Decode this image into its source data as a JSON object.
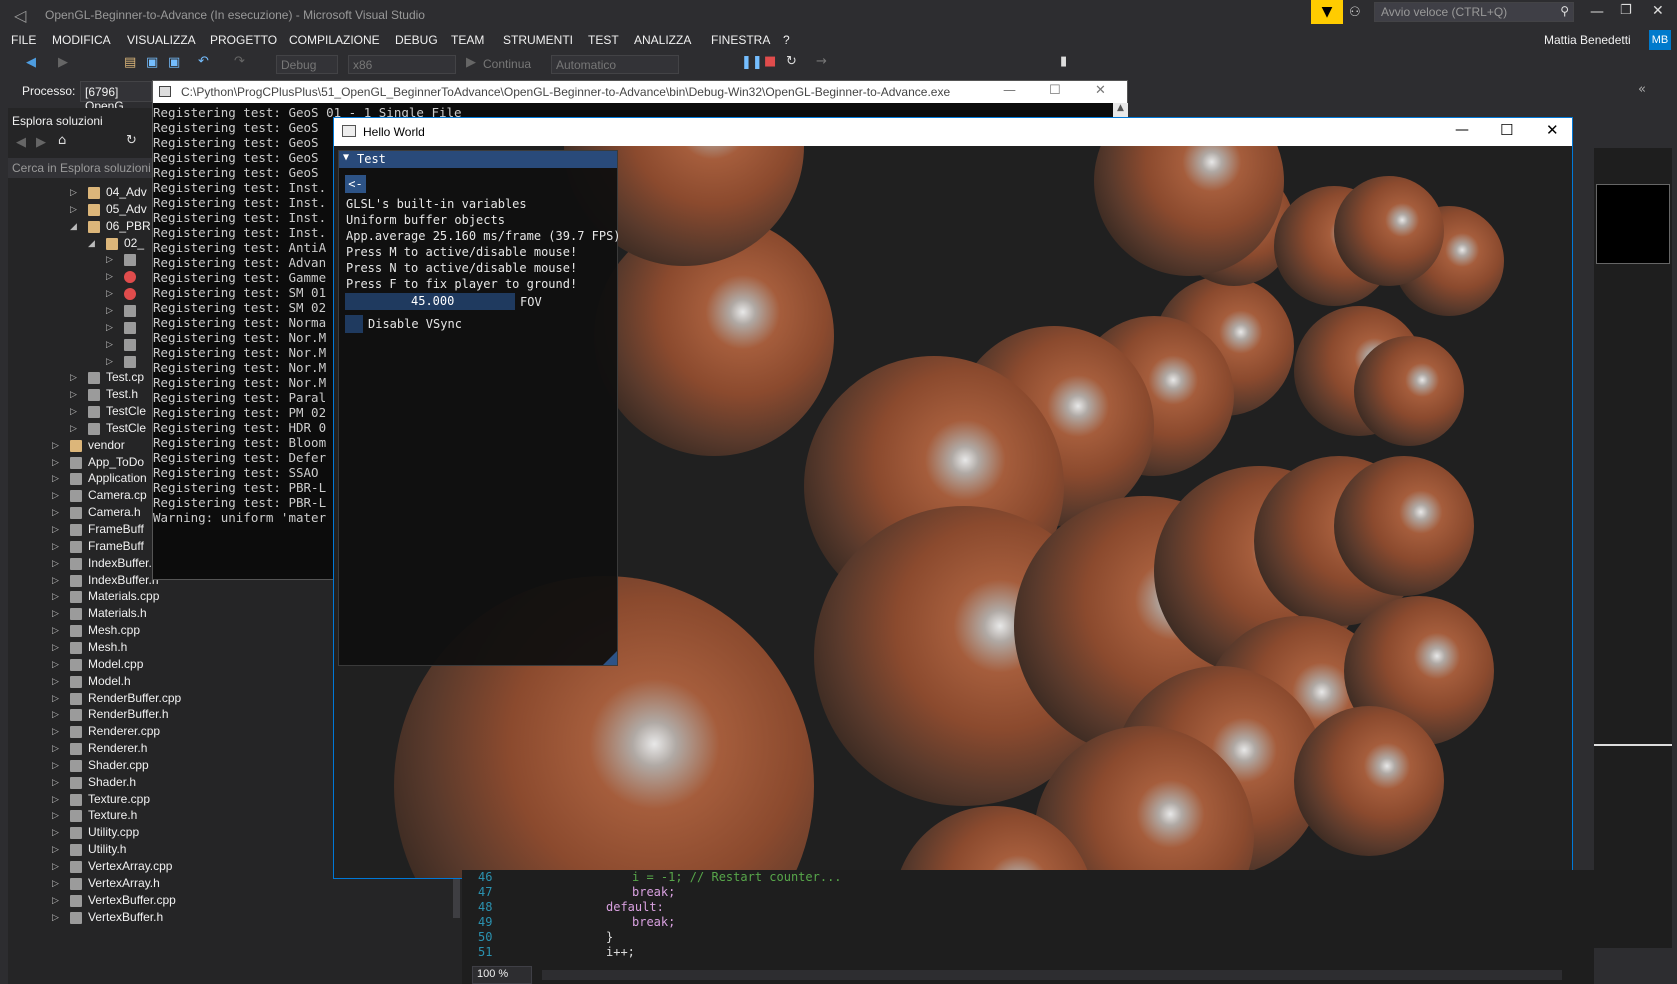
{
  "vs": {
    "title": "OpenGL-Beginner-to-Advance (In esecuzione) - Microsoft Visual Studio",
    "quick_launch_placeholder": "Avvio veloce (CTRL+Q)",
    "user": "Mattia Benedetti",
    "user_initials": "MB",
    "menu": [
      "FILE",
      "MODIFICA",
      "VISUALIZZA",
      "PROGETTO",
      "COMPILAZIONE",
      "DEBUG",
      "TEAM",
      "STRUMENTI",
      "TEST",
      "ANALIZZA",
      "FINESTRA",
      "?"
    ],
    "toolbar": {
      "config": "Debug",
      "platform": "x86",
      "continue": "Continua",
      "mode": "Automatico"
    },
    "process_label": "Processo:",
    "process_value": "[6796] OpenG",
    "accent": "#ffcc00"
  },
  "solution_explorer": {
    "title": "Esplora soluzioni",
    "search_placeholder": "Cerca in Esplora soluzioni",
    "items": [
      {
        "label": "04_Adv",
        "indent": 3,
        "type": "folder"
      },
      {
        "label": "05_Adv",
        "indent": 3,
        "type": "folder"
      },
      {
        "label": "06_PBR",
        "indent": 3,
        "type": "folder",
        "open": true
      },
      {
        "label": "02_",
        "indent": 4,
        "type": "folder",
        "open": true
      },
      {
        "label": "",
        "indent": 5,
        "type": "cpp"
      },
      {
        "label": "",
        "indent": 5,
        "type": "err"
      },
      {
        "label": "",
        "indent": 5,
        "type": "err"
      },
      {
        "label": "",
        "indent": 5,
        "type": "cpp"
      },
      {
        "label": "",
        "indent": 5,
        "type": "h"
      },
      {
        "label": "",
        "indent": 5,
        "type": "cpp"
      },
      {
        "label": "",
        "indent": 5,
        "type": "h"
      },
      {
        "label": "Test.cp",
        "indent": 3,
        "type": "cpp"
      },
      {
        "label": "Test.h",
        "indent": 3,
        "type": "h"
      },
      {
        "label": "TestCle",
        "indent": 3,
        "type": "cpp"
      },
      {
        "label": "TestCle",
        "indent": 3,
        "type": "h"
      },
      {
        "label": "vendor",
        "indent": 2,
        "type": "folder"
      },
      {
        "label": "App_ToDo",
        "indent": 2,
        "type": "h"
      },
      {
        "label": "Application",
        "indent": 2,
        "type": "cpp"
      },
      {
        "label": "Camera.cp",
        "indent": 2,
        "type": "cpp"
      },
      {
        "label": "Camera.h",
        "indent": 2,
        "type": "h"
      },
      {
        "label": "FrameBuff",
        "indent": 2,
        "type": "cpp"
      },
      {
        "label": "FrameBuff",
        "indent": 2,
        "type": "h"
      },
      {
        "label": "IndexBuffer.cpp",
        "indent": 2,
        "type": "cpp"
      },
      {
        "label": "IndexBuffer.h",
        "indent": 2,
        "type": "h"
      },
      {
        "label": "Materials.cpp",
        "indent": 2,
        "type": "cpp"
      },
      {
        "label": "Materials.h",
        "indent": 2,
        "type": "h"
      },
      {
        "label": "Mesh.cpp",
        "indent": 2,
        "type": "cpp"
      },
      {
        "label": "Mesh.h",
        "indent": 2,
        "type": "h"
      },
      {
        "label": "Model.cpp",
        "indent": 2,
        "type": "cpp"
      },
      {
        "label": "Model.h",
        "indent": 2,
        "type": "h"
      },
      {
        "label": "RenderBuffer.cpp",
        "indent": 2,
        "type": "cpp"
      },
      {
        "label": "RenderBuffer.h",
        "indent": 2,
        "type": "h"
      },
      {
        "label": "Renderer.cpp",
        "indent": 2,
        "type": "cpp"
      },
      {
        "label": "Renderer.h",
        "indent": 2,
        "type": "h"
      },
      {
        "label": "Shader.cpp",
        "indent": 2,
        "type": "cpp"
      },
      {
        "label": "Shader.h",
        "indent": 2,
        "type": "h"
      },
      {
        "label": "Texture.cpp",
        "indent": 2,
        "type": "cpp"
      },
      {
        "label": "Texture.h",
        "indent": 2,
        "type": "h"
      },
      {
        "label": "Utility.cpp",
        "indent": 2,
        "type": "cpp"
      },
      {
        "label": "Utility.h",
        "indent": 2,
        "type": "h"
      },
      {
        "label": "VertexArray.cpp",
        "indent": 2,
        "type": "cpp"
      },
      {
        "label": "VertexArray.h",
        "indent": 2,
        "type": "h"
      },
      {
        "label": "VertexBuffer.cpp",
        "indent": 2,
        "type": "cpp"
      },
      {
        "label": "VertexBuffer.h",
        "indent": 2,
        "type": "h"
      }
    ]
  },
  "console": {
    "title": "C:\\Python\\ProgCPlusPlus\\51_OpenGL_BeginnerToAdvance\\OpenGL-Beginner-to-Advance\\bin\\Debug-Win32\\OpenGL-Beginner-to-Advance.exe",
    "lines": [
      "Registering test: GeoS 01 - 1 Single File",
      "Registering test: GeoS",
      "Registering test: GeoS",
      "Registering test: GeoS",
      "Registering test: GeoS",
      "Registering test: Inst.",
      "Registering test: Inst.",
      "Registering test: Inst.",
      "Registering test: Inst.",
      "Registering test: AntiA",
      "Registering test: Advan",
      "Registering test: Gamme",
      "Registering test: SM 01",
      "Registering test: SM 02",
      "Registering test: Norma",
      "Registering test: Nor.M",
      "Registering test: Nor.M",
      "Registering test: Nor.M",
      "Registering test: Nor.M",
      "Registering test: Paral",
      "Registering test: PM 02",
      "Registering test: HDR 0",
      "Registering test: Bloom",
      "Registering test: Defer",
      "Registering test: SSAO",
      "Registering test: PBR-L",
      "Registering test: PBR-L",
      "Warning: uniform 'mater"
    ]
  },
  "hello": {
    "title": "Hello World",
    "imgui": {
      "title": "Test",
      "back": "<-",
      "lines": [
        "GLSL's built-in variables",
        "Uniform buffer objects",
        "App.average 25.160 ms/frame (39.7 FPS)",
        "Press M to active/disable mouse!",
        "Press N to active/disable mouse!",
        "Press F to fix player to ground!"
      ],
      "fov_value": "45.000",
      "fov_label": "FOV",
      "vsync_label": "Disable VSync"
    }
  },
  "code": {
    "lines": [
      {
        "num": "46",
        "text": "i = -1; // Restart counter..."
      },
      {
        "num": "47",
        "text": "break;"
      },
      {
        "num": "48",
        "text": "default:"
      },
      {
        "num": "49",
        "text": "break;"
      },
      {
        "num": "50",
        "text": "}"
      },
      {
        "num": "51",
        "text": "i++;"
      }
    ],
    "zoom": "100 %"
  }
}
